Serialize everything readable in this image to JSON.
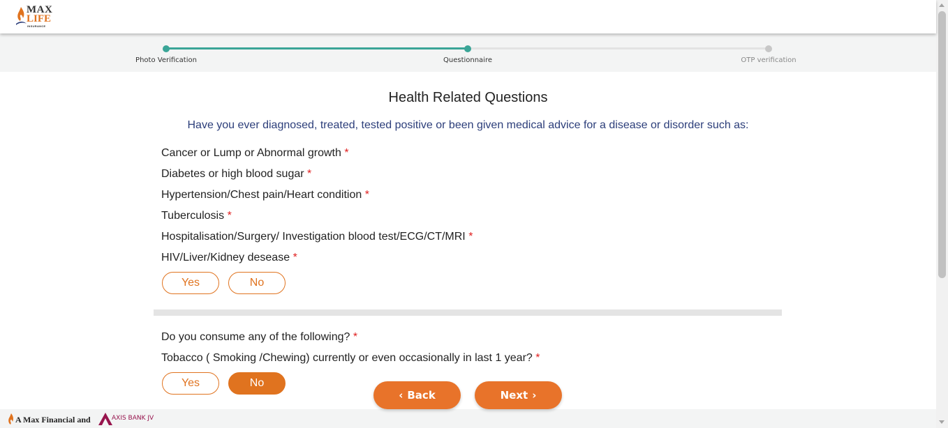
{
  "header": {
    "logo_line1": "MAX",
    "logo_line2": "LIFE",
    "logo_line3": "INSURANCE"
  },
  "stepper": {
    "steps": [
      {
        "label": "Photo Verification",
        "state": "completed"
      },
      {
        "label": "Questionnaire",
        "state": "active"
      },
      {
        "label": "OTP verification",
        "state": "pending"
      }
    ],
    "colors": {
      "completed": "#3aa597",
      "pending": "#c7c7c7"
    }
  },
  "main": {
    "title": "Health Related Questions",
    "subtitle": "Have you ever diagnosed, treated, tested positive or been given medical advice for a disease or disorder such as:",
    "health_items": [
      "Cancer or Lump or Abnormal growth",
      "Diabetes or high blood sugar",
      "Hypertension/Chest pain/Heart condition",
      "Tuberculosis",
      "Hospitalisation/Surgery/ Investigation blood test/ECG/CT/MRI",
      "HIV/Liver/Kidney desease"
    ],
    "required_mark": "*",
    "yes_label": "Yes",
    "no_label": "No",
    "consume_question": "Do you consume any of the following?",
    "tobacco_question": "Tobacco ( Smoking /Chewing) currently or even occasionally in last 1 year?",
    "tobacco_selected": "No"
  },
  "nav": {
    "back_label": "Back",
    "next_label": "Next",
    "accent": "#e8732a"
  },
  "footer": {
    "text": "A Max Financial and",
    "partner": "AXIS BANK JV"
  }
}
